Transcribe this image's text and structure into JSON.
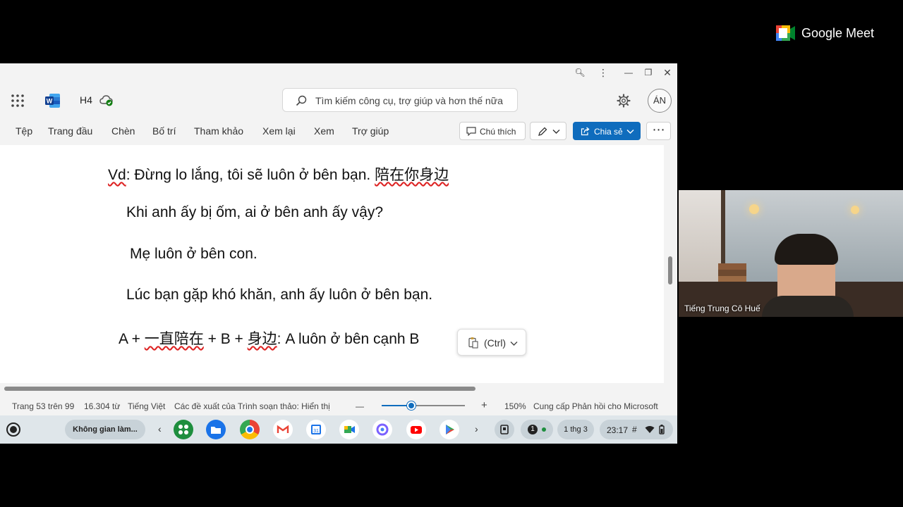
{
  "meet": {
    "brand": "Google Meet",
    "participant_name": "Tiếng Trung Cô Huế"
  },
  "app": {
    "doc_name": "H4",
    "avatar_initials": "ÁN"
  },
  "search": {
    "placeholder": "Tìm kiếm công cụ, trợ giúp và hơn thế nữa"
  },
  "ribbon": {
    "tabs": [
      "Tệp",
      "Trang đầu",
      "Chèn",
      "Bố trí",
      "Tham khảo",
      "Xem lại",
      "Xem",
      "Trợ giúp"
    ],
    "comment_label": "Chú thích",
    "share_label": "Chia sẻ"
  },
  "document": {
    "line1_prefix": "Vd",
    "line1_text": ": Đừng lo lắng, tôi sẽ luôn ở bên bạn. ",
    "line1_chinese": "陪在你身边",
    "line2": "Khi anh ấy bị ốm, ai ở bên anh ấy vậy?",
    "line3": "Mẹ luôn ở bên con.",
    "line4": "Lúc bạn gặp khó khăn, anh ấy luôn ở bên bạn.",
    "line5_a": "A + ",
    "line5_zh1": "一直陪在",
    "line5_b": " + B + ",
    "line5_zh2": "身边",
    "line5_rest": ": A luôn ở bên cạnh B"
  },
  "paste_popup": {
    "label": "(Ctrl)"
  },
  "statusbar": {
    "page": "Trang 53 trên 99",
    "words": "16.304 từ",
    "language": "Tiếng Việt",
    "editor": "Các đề xuất của Trình soạn thảo: Hiển thị",
    "minus": "—",
    "plus": "+",
    "zoom": "150%",
    "feedback": "Cung cấp Phản hồi cho Microsoft",
    "zoom_level": 0.36
  },
  "shelf": {
    "workspace_label": "Không gian làm...",
    "notification_count": "1",
    "date": "1 thg 3",
    "time": "23:17"
  },
  "colors": {
    "share_button": "#0f6cbd",
    "squiggle": "#dd2222",
    "shelf_bg": "#dfe6ea"
  }
}
